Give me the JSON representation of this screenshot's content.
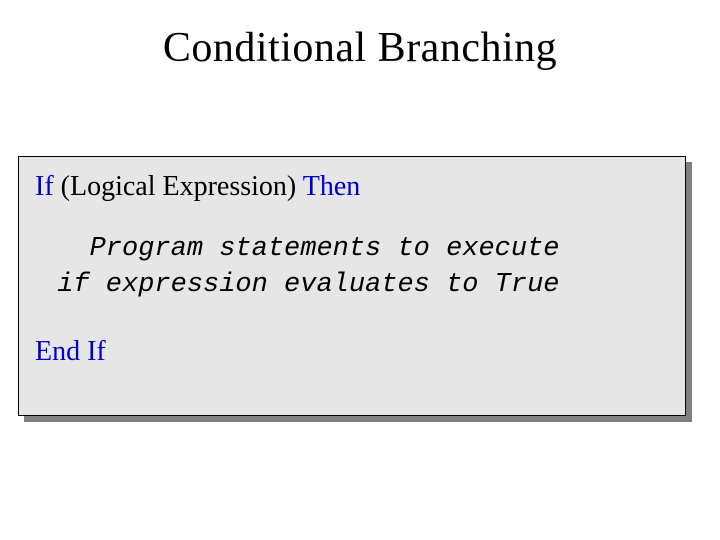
{
  "title": "Conditional Branching",
  "code": {
    "kw_if": "If",
    "expr": "  (Logical Expression)  ",
    "kw_then": "Then",
    "body": "   Program statements to execute\n if expression evaluates to True",
    "kw_endif": "End If"
  }
}
